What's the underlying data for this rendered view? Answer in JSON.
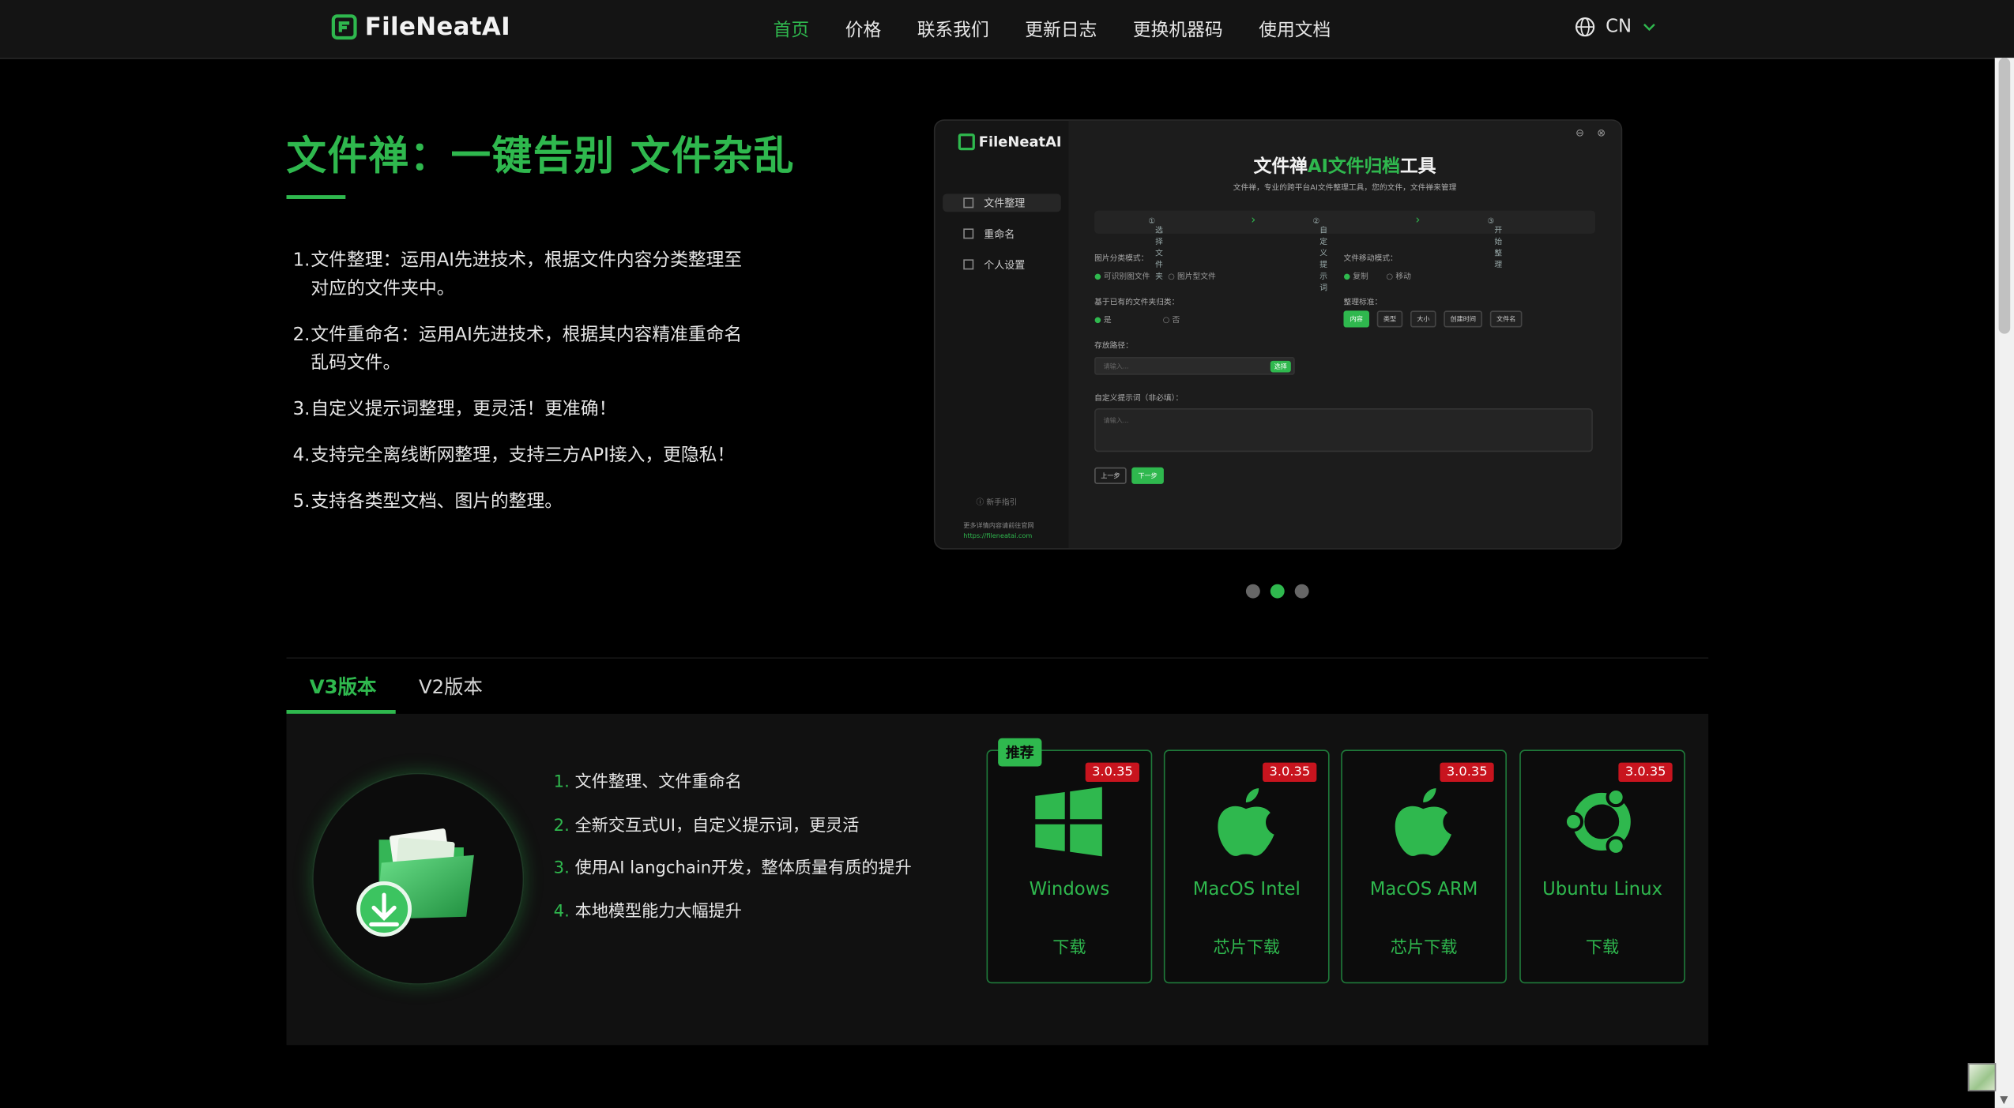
{
  "header": {
    "logo_text": "FileNeatAI",
    "nav": [
      "首页",
      "价格",
      "联系我们",
      "更新日志",
      "更换机器码",
      "使用文档"
    ],
    "active_nav": "首页",
    "language": "CN"
  },
  "hero": {
    "title": "文件禅：一键告别 文件杂乱",
    "features": [
      {
        "num": "1.",
        "text": "文件整理：运用AI先进技术，根据文件内容分类整理至对应的文件夹中。"
      },
      {
        "num": "2.",
        "text": "文件重命名：运用AI先进技术，根据其内容精准重命名乱码文件。"
      },
      {
        "num": "3.",
        "text": "自定义提示词整理，更灵活！更准确！"
      },
      {
        "num": "4.",
        "text": "支持完全离线断网整理，支持三方API接入，更隐私！"
      },
      {
        "num": "5.",
        "text": "支持各类型文档、图片的整理。"
      }
    ]
  },
  "app_preview": {
    "logo_text": "FileNeatAI",
    "sidebar": [
      "文件整理",
      "重命名",
      "个人设置"
    ],
    "sidebar_help": "新手指引",
    "sidebar_footer": "更多详情内容请前往官网",
    "sidebar_url": "https://fileneatai.com",
    "title_a": "文件禅",
    "title_b": "AI文件归档",
    "title_c": "工具",
    "subtitle": "文件禅，专业的跨平台AI文件整理工具，您的文件，文件禅来管理",
    "steps": [
      "选择文件夹",
      "自定义提示词",
      "开始整理"
    ],
    "mode_label": "图片分类模式：",
    "mode_opts": [
      "可识别图文件",
      "图片型文件"
    ],
    "move_label": "文件移动模式：",
    "move_opts": [
      "复制",
      "移动"
    ],
    "based_label": "基于已有的文件夹归类：",
    "based_opts": [
      "是",
      "否"
    ],
    "sort_label": "整理标准：",
    "sort_chips": [
      "内容",
      "类型",
      "大小",
      "创建时间",
      "文件名"
    ],
    "path_label": "存放路径：",
    "path_placeholder": "请输入...",
    "path_button": "选择",
    "prompt_label": "自定义提示词（非必填）：",
    "prompt_placeholder": "请输入...",
    "prev_button": "上一步",
    "next_button": "下一步"
  },
  "carousel": {
    "count": 3,
    "active": 1
  },
  "tabs": [
    "V3版本",
    "V2版本"
  ],
  "v3": {
    "features": [
      {
        "num": "1.",
        "text": "文件整理、文件重命名"
      },
      {
        "num": "2.",
        "text": "全新交互式UI，自定义提示词，更灵活"
      },
      {
        "num": "3.",
        "text": "使用AI langchain开发，整体质量有质的提升"
      },
      {
        "num": "4.",
        "text": "本地模型能力大幅提升"
      }
    ],
    "recommend_badge": "推荐",
    "downloads": [
      {
        "name": "Windows",
        "action": "下载",
        "version": "3.0.35",
        "icon": "windows-icon"
      },
      {
        "name": "MacOS Intel",
        "action": "芯片下载",
        "version": "3.0.35",
        "icon": "apple-icon"
      },
      {
        "name": "MacOS ARM",
        "action": "芯片下载",
        "version": "3.0.35",
        "icon": "apple-icon"
      },
      {
        "name": "Ubuntu Linux",
        "action": "下载",
        "version": "3.0.35",
        "icon": "ubuntu-icon"
      }
    ]
  },
  "colors": {
    "accent": "#2fb84e",
    "version_badge": "#c8141e",
    "background": "#000000"
  }
}
